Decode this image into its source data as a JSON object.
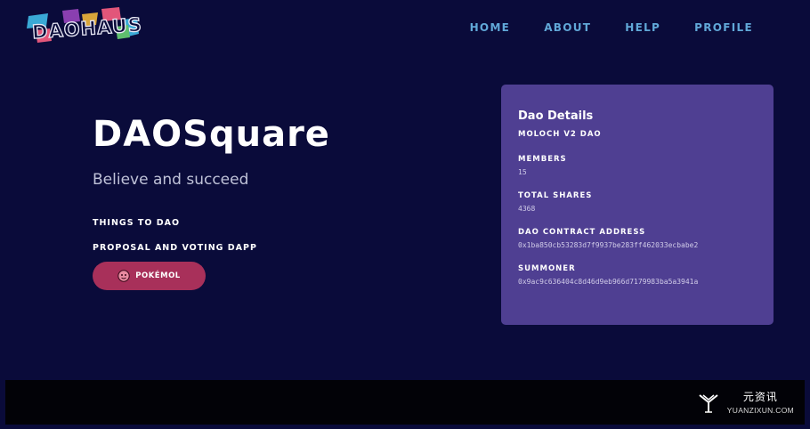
{
  "header": {
    "logo_text": "DAOHAUS",
    "nav": [
      "HOME",
      "ABOUT",
      "HELP",
      "PROFILE"
    ]
  },
  "hero": {
    "title": "DAOSquare",
    "tagline": "Believe and succeed",
    "tags": [
      "THINGS TO DAO",
      "PROPOSAL AND VOTING DAPP"
    ],
    "button_label": "POKÉMOL",
    "button_color": "#a8305a"
  },
  "details": {
    "title": "Dao Details",
    "subtitle": "MOLOCH V2 DAO",
    "fields": [
      {
        "label": "MEMBERS",
        "value": "15"
      },
      {
        "label": "TOTAL SHARES",
        "value": "4368"
      },
      {
        "label": "DAO CONTRACT ADDRESS",
        "value": "0x1ba850cb53283d7f9937be283ff462033ecbabe2"
      },
      {
        "label": "SUMMONER",
        "value": "0x9ac9c636404c8d46d9eb966d7179983ba5a3941a"
      }
    ],
    "card_color": "#4f3f92"
  },
  "watermark": {
    "cn": "元资讯",
    "en": "YUANZIXUN.COM"
  },
  "colors": {
    "background": "#0a0b3a",
    "nav_link": "#61a8d8"
  }
}
